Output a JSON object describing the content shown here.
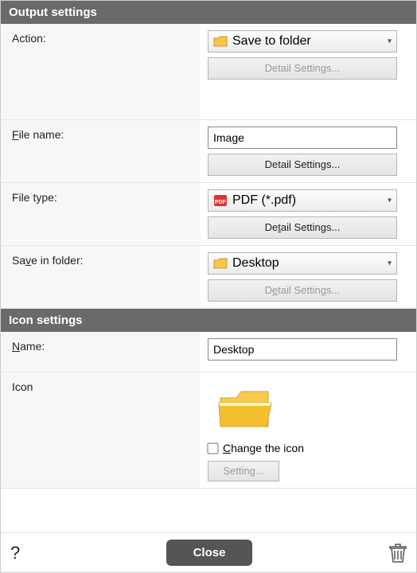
{
  "sections": {
    "output": {
      "title": "Output settings"
    },
    "icon": {
      "title": "Icon settings"
    }
  },
  "output": {
    "action": {
      "label": "Action:",
      "value": "Save to folder",
      "detail": "Detail Settings..."
    },
    "filename": {
      "label": "File name:",
      "value": "Image",
      "detail": "Detail Settings..."
    },
    "filetype": {
      "label": "File type:",
      "value": "PDF (*.pdf)",
      "detail": "Detail Settings..."
    },
    "savein": {
      "label": "Save in folder:",
      "value": "Desktop",
      "detail": "Detail Settings..."
    }
  },
  "iconSettings": {
    "name": {
      "label": "Name:",
      "value": "Desktop"
    },
    "icon": {
      "label": "Icon",
      "changeLabel": "Change the icon",
      "settingLabel": "Setting..."
    }
  },
  "footer": {
    "close": "Close"
  }
}
